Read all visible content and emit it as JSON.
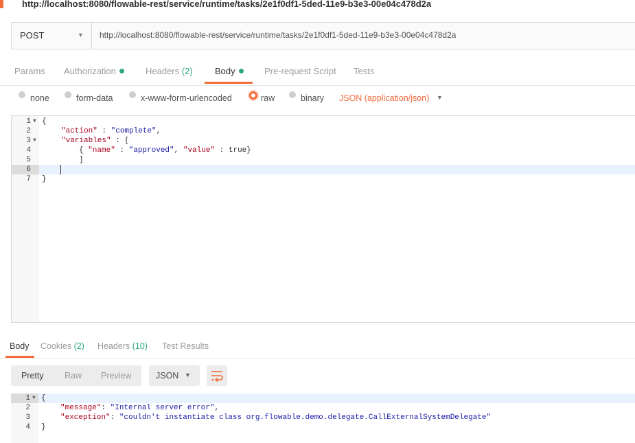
{
  "title_url": "http://localhost:8080/flowable-rest/service/runtime/tasks/2e1f0df1-5ded-11e9-b3e3-00e04c478d2a",
  "request": {
    "method": "POST",
    "url": "http://localhost:8080/flowable-rest/service/runtime/tasks/2e1f0df1-5ded-11e9-b3e3-00e04c478d2a"
  },
  "request_tabs": {
    "params": "Params",
    "authorization": "Authorization",
    "headers": "Headers",
    "headers_count": "(2)",
    "body": "Body",
    "prerequest": "Pre-request Script",
    "tests": "Tests"
  },
  "body_types": {
    "none": "none",
    "form_data": "form-data",
    "urlencoded": "x-www-form-urlencoded",
    "raw": "raw",
    "binary": "binary",
    "content_type": "JSON (application/json)"
  },
  "request_body": {
    "line_numbers": [
      "1",
      "2",
      "3",
      "4",
      "5",
      "6",
      "7"
    ],
    "l1": "{",
    "l2_key": "\"action\"",
    "l2_sep": " : ",
    "l2_val": "\"complete\"",
    "l2_end": ",",
    "l3_key": "\"variables\"",
    "l3_rest": " : [",
    "l4_open": "{ ",
    "l4_k1": "\"name\"",
    "l4_sep1": " : ",
    "l4_v1": "\"approved\"",
    "l4_comma": ", ",
    "l4_k2": "\"value\"",
    "l4_rest": " : true}",
    "l5": "]",
    "l7": "}"
  },
  "response_tabs": {
    "body": "Body",
    "cookies": "Cookies",
    "cookies_count": "(2)",
    "headers": "Headers",
    "headers_count": "(10)",
    "test_results": "Test Results"
  },
  "response_toolbar": {
    "pretty": "Pretty",
    "raw": "Raw",
    "preview": "Preview",
    "format": "JSON"
  },
  "response_body": {
    "line_numbers": [
      "1",
      "2",
      "3",
      "4"
    ],
    "l1": "{",
    "l2_key": "\"message\"",
    "l2_sep": ": ",
    "l2_val": "\"Internal server error\"",
    "l2_end": ",",
    "l3_key": "\"exception\"",
    "l3_sep": ": ",
    "l3_val": "\"couldn't instantiate class org.flowable.demo.delegate.CallExternalSystemDelegate\"",
    "l4": "}"
  },
  "colors": {
    "accent": "#f26b3a",
    "count_green": "#2aa876",
    "json_key": "#a8001b",
    "json_string": "#1a1aa6"
  },
  "icons": {
    "method_dropdown": "chevron-down-icon",
    "content_type_dropdown": "chevron-down-icon",
    "fold": "fold-arrow-icon",
    "wrap": "wrap-lines-icon"
  }
}
